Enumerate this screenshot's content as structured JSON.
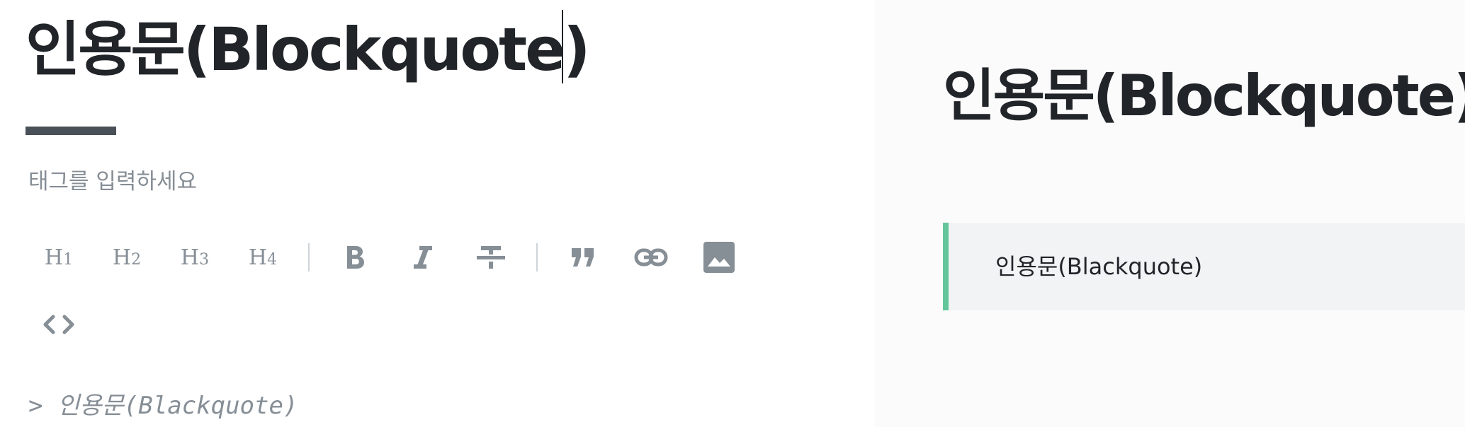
{
  "editor": {
    "title_value": "인용문(Blockquote)",
    "tag_placeholder": "태그를 입력하세요",
    "markdown_line": "> 인용문(Blackquote)"
  },
  "toolbar": {
    "h1": {
      "label": "H",
      "sub": "1"
    },
    "h2": {
      "label": "H",
      "sub": "2"
    },
    "h3": {
      "label": "H",
      "sub": "3"
    },
    "h4": {
      "label": "H",
      "sub": "4"
    },
    "icons": [
      "bold-icon",
      "italic-icon",
      "strikethrough-icon",
      "quote-icon",
      "link-icon",
      "image-icon",
      "code-icon"
    ]
  },
  "preview": {
    "title": "인용문(Blockquote)",
    "blockquote_text": "인용문(Blackquote)"
  },
  "colors": {
    "text_dark": "#212529",
    "text_muted": "#868e96",
    "quote_accent": "#63c69a",
    "quote_bg": "#f1f3f5",
    "preview_bg": "#fbfbfc"
  }
}
